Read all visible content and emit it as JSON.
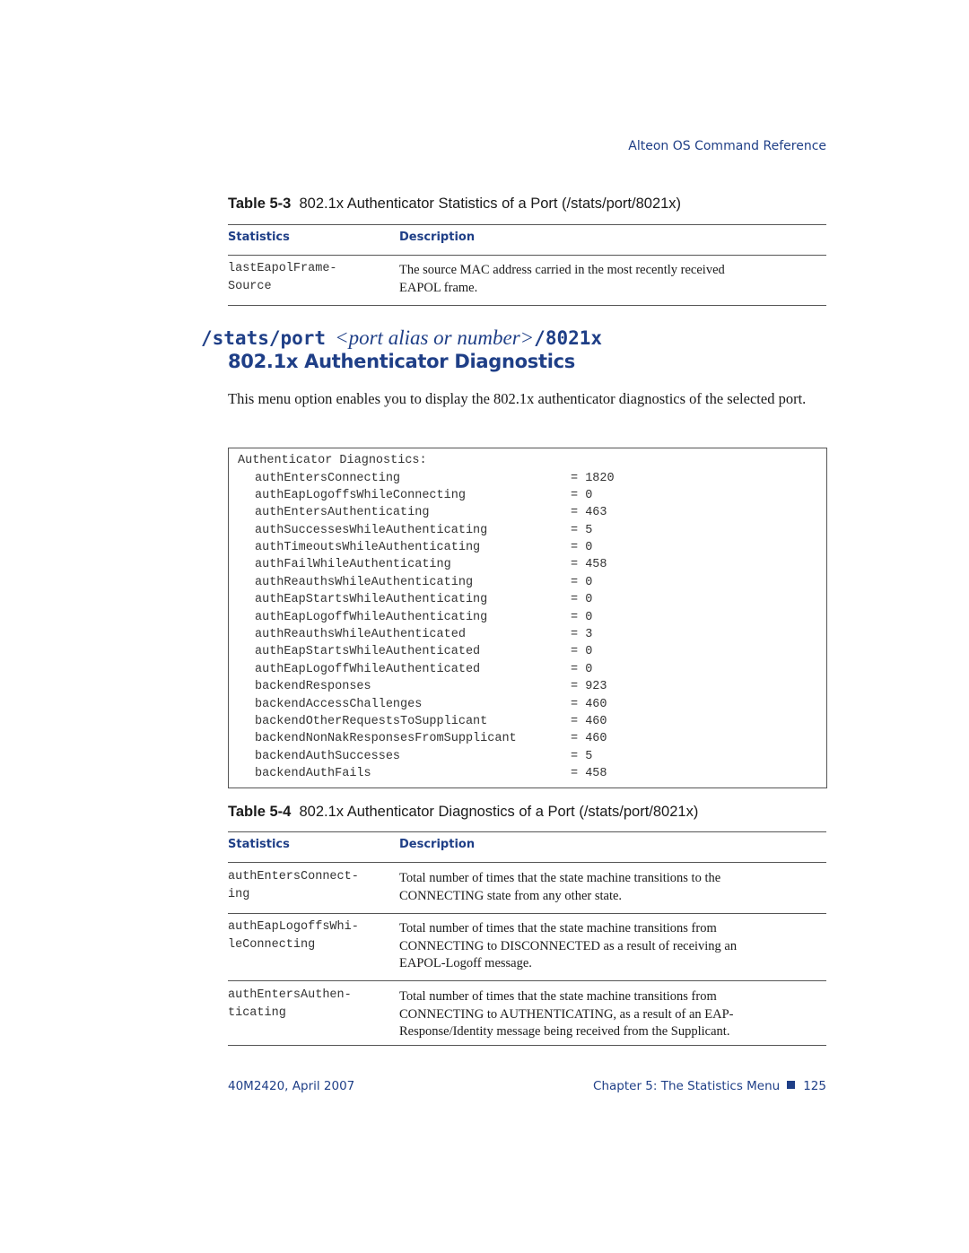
{
  "running_header": "Alteon OS  Command Reference",
  "table_5_3": {
    "label": "Table 5-3",
    "caption": "802.1x Authenticator Statistics of a Port (/stats/port/8021x)",
    "headers": [
      "Statistics",
      "Description"
    ],
    "rows": [
      {
        "stat_line1": "lastEapolFrame-",
        "stat_line2": "Source",
        "desc_line1": "The source MAC address carried in the most recently received",
        "desc_line2": "EAPOL frame."
      }
    ]
  },
  "section": {
    "command_prefix": "/stats/port",
    "command_param": "<port alias or number>",
    "command_suffix": "/8021x",
    "title": "802.1x Authenticator Diagnostics",
    "intro": "This menu option enables you to display the 802.1x authenticator diagnostics of the selected port."
  },
  "code_output": {
    "title": "Authenticator Diagnostics:",
    "rows": [
      {
        "name": "authEntersConnecting",
        "value": "= 1820"
      },
      {
        "name": "authEapLogoffsWhileConnecting",
        "value": "= 0"
      },
      {
        "name": "authEntersAuthenticating",
        "value": "= 463"
      },
      {
        "name": "authSuccessesWhileAuthenticating",
        "value": "= 5"
      },
      {
        "name": "authTimeoutsWhileAuthenticating",
        "value": "= 0"
      },
      {
        "name": "authFailWhileAuthenticating",
        "value": "= 458"
      },
      {
        "name": "authReauthsWhileAuthenticating",
        "value": "= 0"
      },
      {
        "name": "authEapStartsWhileAuthenticating",
        "value": "= 0"
      },
      {
        "name": "authEapLogoffWhileAuthenticating",
        "value": "= 0"
      },
      {
        "name": "authReauthsWhileAuthenticated",
        "value": "= 3"
      },
      {
        "name": "authEapStartsWhileAuthenticated",
        "value": "= 0"
      },
      {
        "name": "authEapLogoffWhileAuthenticated",
        "value": "= 0"
      },
      {
        "name": "backendResponses",
        "value": "= 923"
      },
      {
        "name": "backendAccessChallenges",
        "value": "= 460"
      },
      {
        "name": "backendOtherRequestsToSupplicant",
        "value": "= 460"
      },
      {
        "name": "backendNonNakResponsesFromSupplicant",
        "value": "= 460"
      },
      {
        "name": "backendAuthSuccesses",
        "value": "= 5"
      },
      {
        "name": "backendAuthFails",
        "value": "= 458"
      }
    ]
  },
  "table_5_4": {
    "label": "Table 5-4",
    "caption": "802.1x Authenticator Diagnostics of a Port (/stats/port/8021x)",
    "headers": [
      "Statistics",
      "Description"
    ],
    "rows": [
      {
        "stat": [
          "authEntersConnect-",
          "ing"
        ],
        "desc": [
          "Total number of times that the state machine transitions to the",
          "CONNECTING state from any other state."
        ]
      },
      {
        "stat": [
          "authEapLogoffsWhi-",
          "leConnecting"
        ],
        "desc": [
          "Total number of times that the state machine transitions from",
          "CONNECTING to DISCONNECTED as a result of receiving an",
          "EAPOL-Logoff message."
        ]
      },
      {
        "stat": [
          "authEntersAuthen-",
          "ticating"
        ],
        "desc": [
          "Total number of times that the state machine transitions from",
          "CONNECTING to AUTHENTICATING, as a result of an EAP-",
          "Response/Identity message being received from the Supplicant."
        ]
      }
    ]
  },
  "footer": {
    "doc_id": "40M2420, April 2007",
    "chapter": "Chapter 5:  The Statistics Menu",
    "page_number": "125"
  }
}
